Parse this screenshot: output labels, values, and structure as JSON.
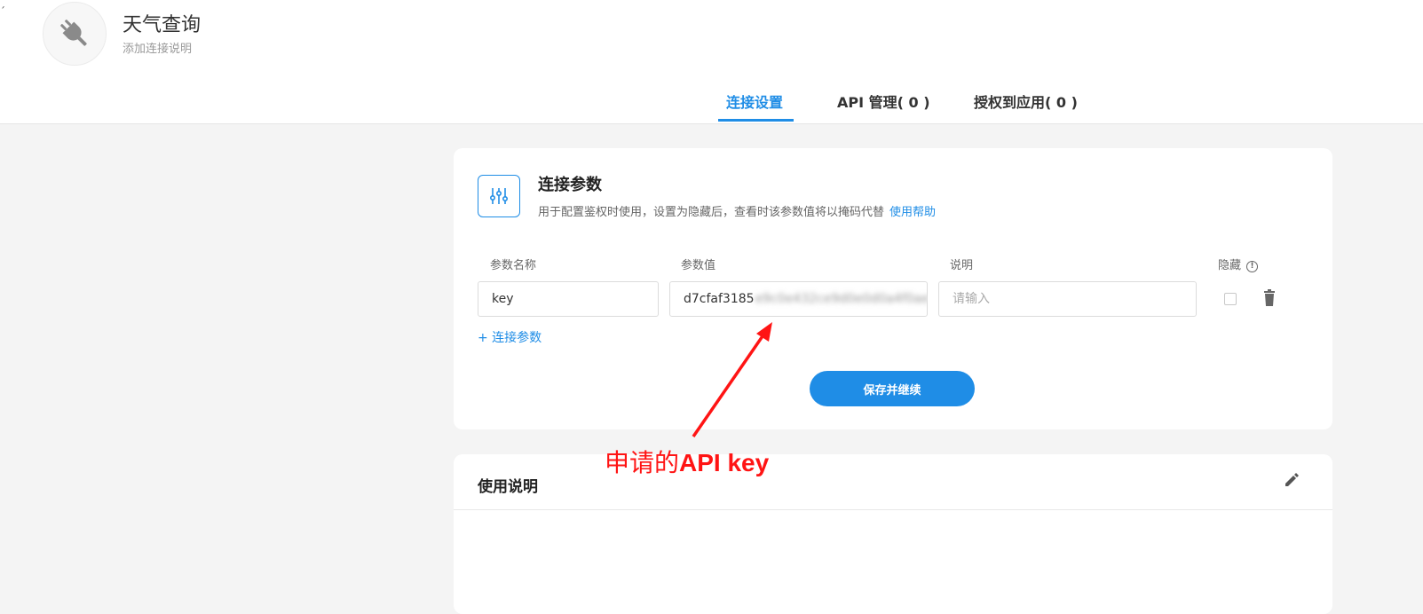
{
  "header": {
    "back_glyph": "ˊ",
    "avatar_icon": "plug-icon",
    "title": "天气查询",
    "subtitle": "添加连接说明",
    "tabs": [
      {
        "label": "连接设置",
        "active": true
      },
      {
        "label": "API 管理( 0 )",
        "active": false
      },
      {
        "label": "授权到应用( 0 )",
        "active": false
      }
    ]
  },
  "connection_params": {
    "icon": "sliders-icon",
    "title": "连接参数",
    "description": "用于配置鉴权时使用，设置为隐藏后，查看时该参数值将以掩码代替",
    "help_link": "使用帮助",
    "columns": {
      "name": "参数名称",
      "value": "参数值",
      "note": "说明",
      "hidden": "隐藏"
    },
    "row": {
      "name": "key",
      "value_visible": "d7cfaf3185",
      "value_blurred": "e9c0e432ce9d0e0d0a4f0ae",
      "note_placeholder": "请输入",
      "hidden_checked": false
    },
    "add_param_label": "+ 连接参数",
    "save_button": "保存并继续"
  },
  "usage": {
    "title": "使用说明",
    "edit_icon": "pencil-icon"
  },
  "annotation": {
    "text_prefix": "申请的",
    "text_bold": "API key",
    "color": "#ff1414"
  },
  "colors": {
    "accent": "#1f8de6",
    "background": "#f4f4f4"
  }
}
